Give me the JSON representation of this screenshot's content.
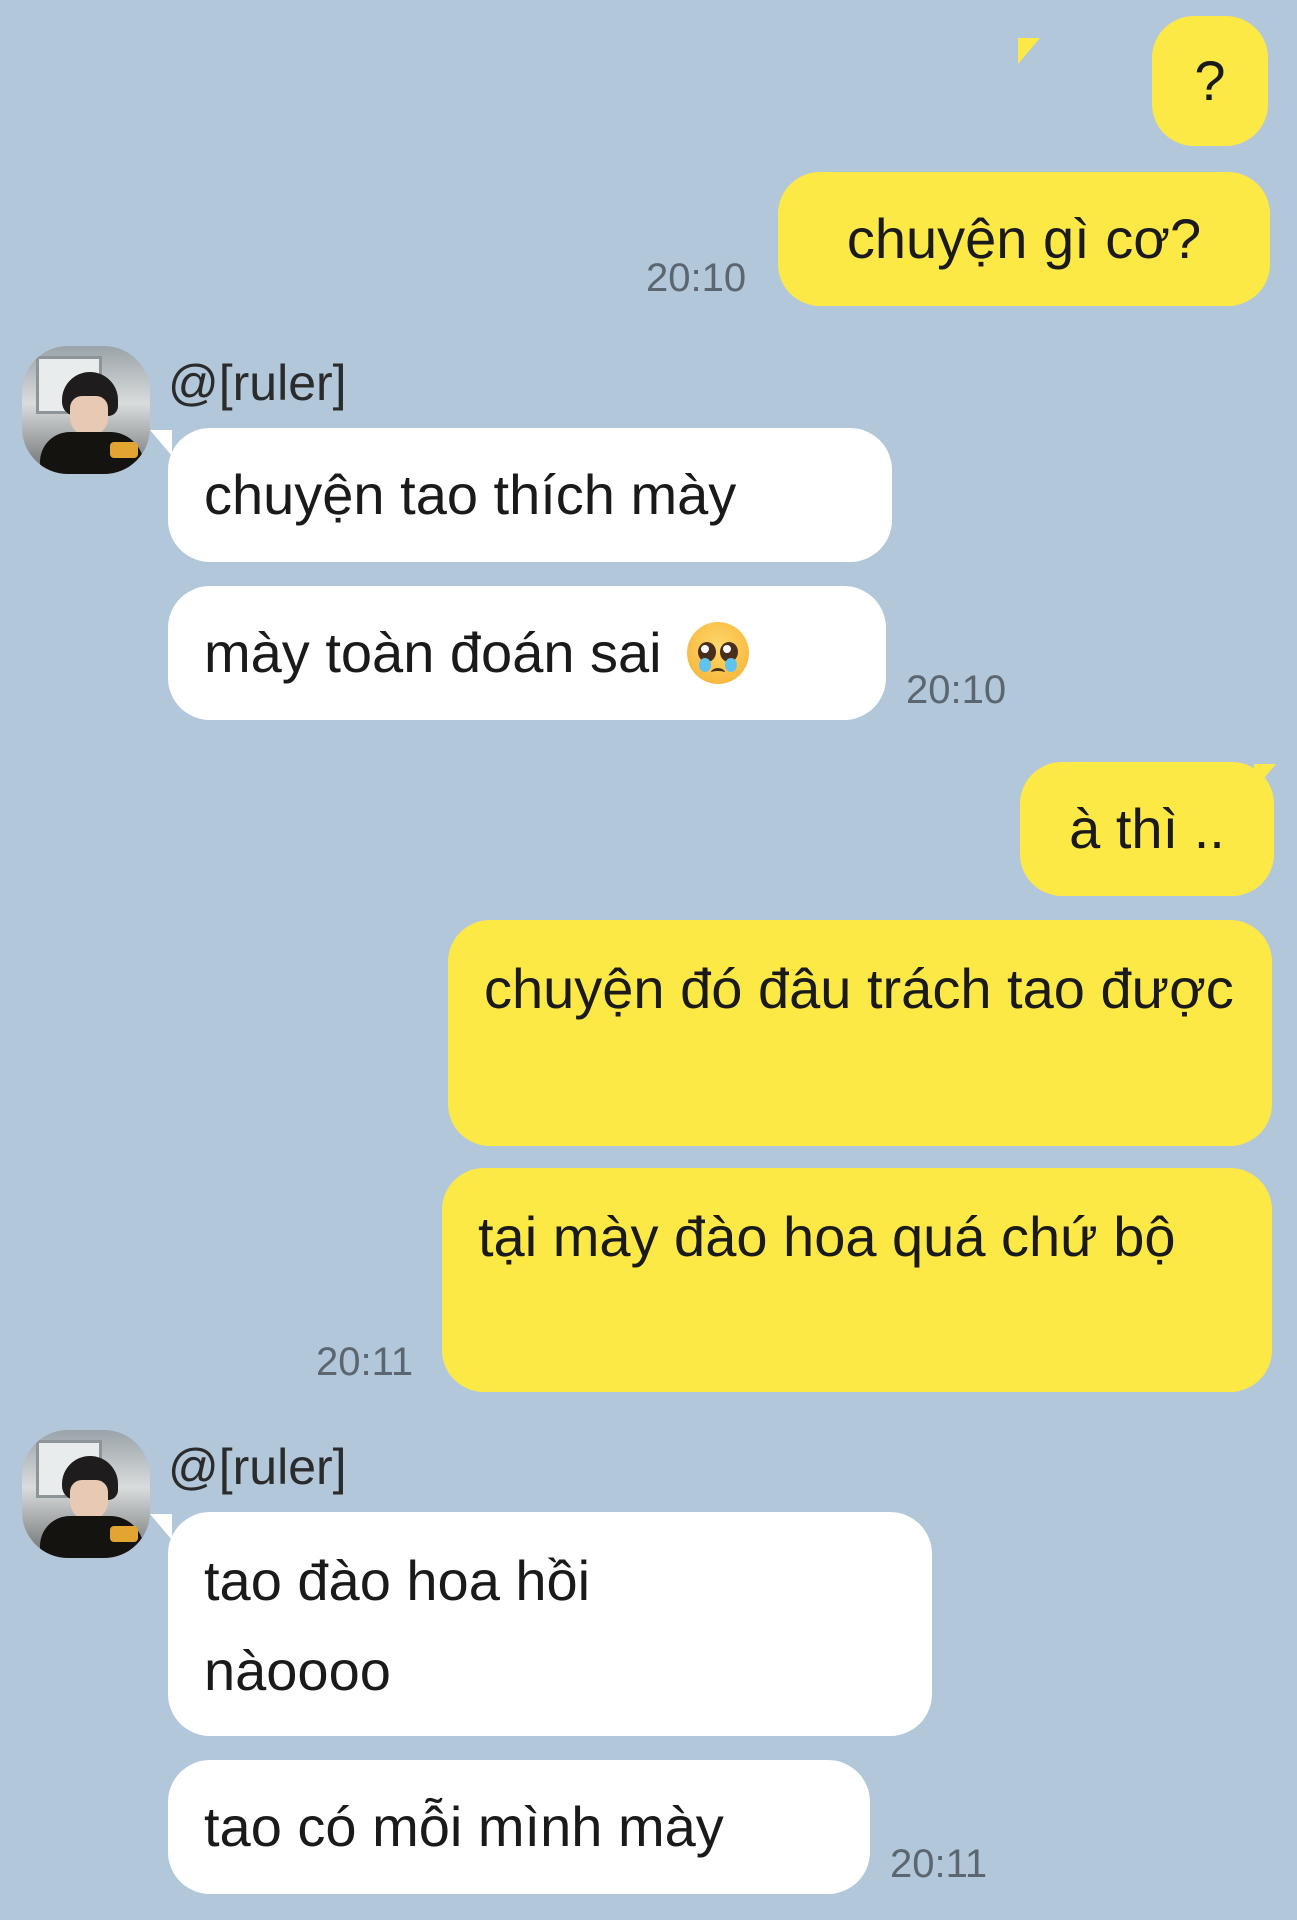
{
  "chat": {
    "sender_name": "@[ruler]",
    "messages": [
      {
        "side": "me",
        "text": "?"
      },
      {
        "side": "me",
        "text": "chuyện gì cơ?",
        "time": "20:10"
      },
      {
        "side": "them",
        "text": "chuyện tao thích mày"
      },
      {
        "side": "them",
        "text": "mày toàn đoán sai",
        "emoji": "pleading-face-icon",
        "time": "20:10"
      },
      {
        "side": "me",
        "text": "à thì .."
      },
      {
        "side": "me",
        "text": "chuyện đó đâu trách tao được"
      },
      {
        "side": "me",
        "text": "tại mày đào hoa quá chứ bộ",
        "time": "20:11"
      },
      {
        "side": "them",
        "text": "tao đào hoa hồi nàoooo"
      },
      {
        "side": "them",
        "text": "tao có mỗi mình mày",
        "time": "20:11"
      }
    ]
  },
  "colors": {
    "background": "#b2c7da",
    "my_bubble": "#fde946",
    "their_bubble": "#ffffff",
    "timestamp": "#5c6670"
  }
}
